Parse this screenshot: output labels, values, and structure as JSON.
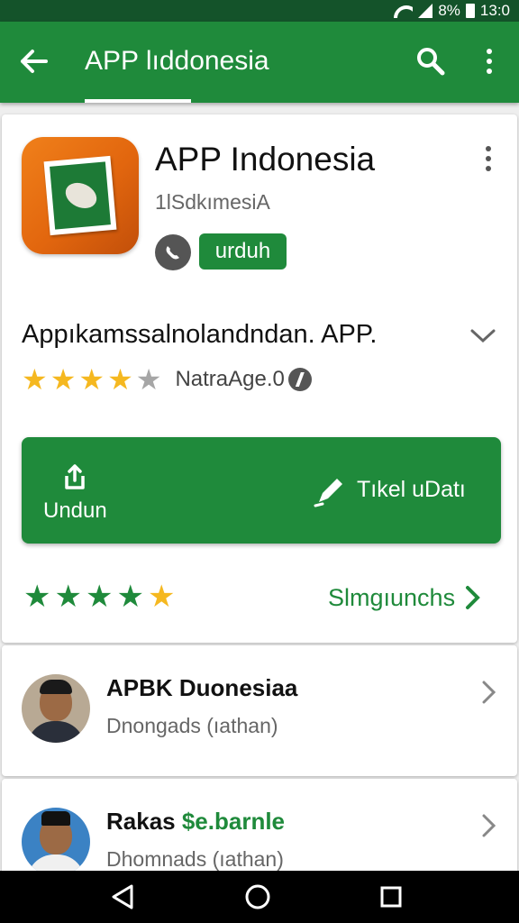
{
  "status_bar": {
    "battery_percent": "8%",
    "time": "13:0"
  },
  "app_bar": {
    "title": "APP lıddonesia",
    "icons": [
      "back-arrow-icon",
      "search-icon",
      "more-vert-icon"
    ]
  },
  "app_card": {
    "name": "APP Indonesia",
    "developer": "1lSdkımesiA",
    "download_badge": "urduh",
    "description": "Appıkamssalnolandndan. APP.",
    "rating_text": "NatraAge.0",
    "rating_stars": 4,
    "install_label": "Undun",
    "review_label": "Tıkel uDatı",
    "user_rating_stars": 5,
    "reviews_link": "Slmgıunchs",
    "accent_color": "#1f8a3b",
    "icon_color": "#e8701a"
  },
  "developers": [
    {
      "name": "APBK Duonesiaa",
      "name_highlight": "",
      "subtitle": "Dnongads (ıathan)"
    },
    {
      "name": "Rakas ",
      "name_highlight": "$e.barnle",
      "subtitle": "Dhomnads (ıathan)"
    }
  ],
  "nav_bar": {
    "icons": [
      "back-triangle-icon",
      "home-circle-icon",
      "recents-square-icon"
    ]
  }
}
